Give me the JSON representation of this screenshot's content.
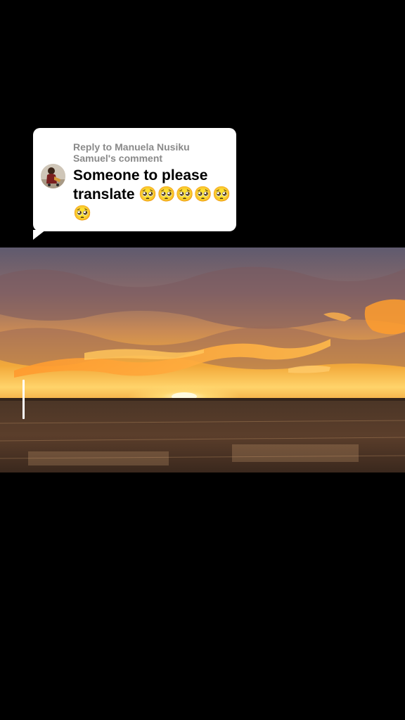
{
  "reply": {
    "header": "Reply to Manuela Nusiku Samuel's comment",
    "comment": "Someone to please translate 🥺🥺🥺🥺🥺🥺"
  },
  "video": {
    "scene": "sunset-over-field"
  },
  "icons": {
    "avatar": "user-avatar"
  }
}
